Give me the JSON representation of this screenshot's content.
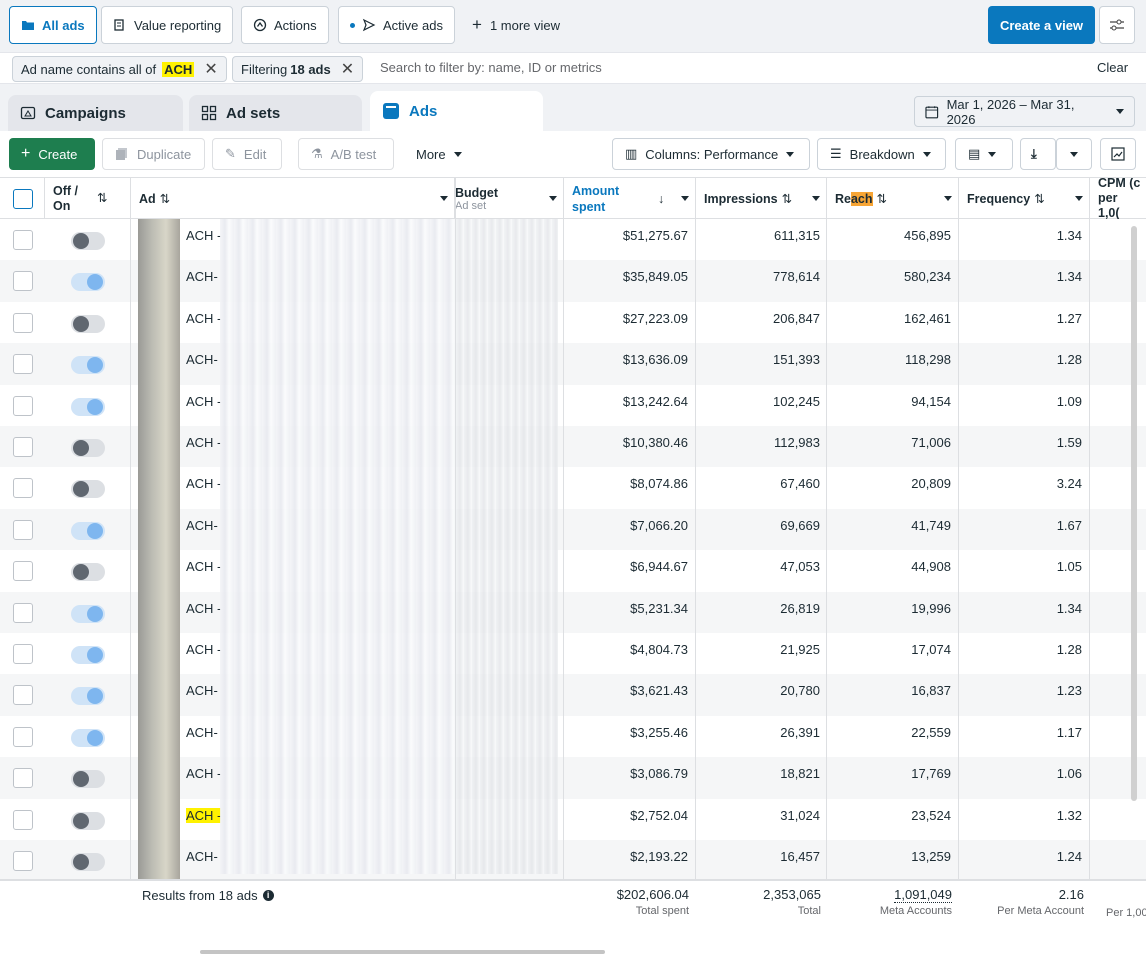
{
  "views": {
    "tabs": [
      {
        "label": "All ads",
        "icon": "folder-icon"
      },
      {
        "label": "Value reporting",
        "icon": "report-icon"
      },
      {
        "label": "Actions",
        "icon": "actions-icon"
      },
      {
        "label": "Active ads",
        "icon": "send-icon"
      }
    ],
    "more_views": "1 more view",
    "create_view": "Create a view"
  },
  "filters": {
    "chip1_prefix": "Ad name contains all of",
    "chip1_value": "ACH",
    "chip2_prefix": "Filtering",
    "chip2_value": "18 ads",
    "search_placeholder": "Search to filter by: name, ID or metrics",
    "clear": "Clear"
  },
  "levels": {
    "campaigns": "Campaigns",
    "adsets": "Ad sets",
    "ads": "Ads"
  },
  "date_range": "Mar 1, 2026 – Mar 31, 2026",
  "toolbar": {
    "create": "Create",
    "duplicate": "Duplicate",
    "edit": "Edit",
    "ab_test": "A/B test",
    "more": "More",
    "columns": "Columns: Performance",
    "breakdown": "Breakdown"
  },
  "columns": {
    "offon": "Off / On",
    "ad": "Ad",
    "budget": "Budget",
    "budget_sub": "Ad set",
    "amount": "Amount spent",
    "impressions": "Impressions",
    "reach_pre": "Re",
    "reach_hl": "ach",
    "frequency": "Frequency",
    "cpm": "CPM (c per 1,0("
  },
  "rows": [
    {
      "on": false,
      "name": "ACH -",
      "spent": "$51,275.67",
      "impr": "611,315",
      "reach": "456,895",
      "freq": "1.34"
    },
    {
      "on": true,
      "name": "ACH-",
      "spent": "$35,849.05",
      "impr": "778,614",
      "reach": "580,234",
      "freq": "1.34"
    },
    {
      "on": false,
      "name": "ACH -",
      "spent": "$27,223.09",
      "impr": "206,847",
      "reach": "162,461",
      "freq": "1.27"
    },
    {
      "on": true,
      "name": "ACH-",
      "spent": "$13,636.09",
      "impr": "151,393",
      "reach": "118,298",
      "freq": "1.28"
    },
    {
      "on": true,
      "name": "ACH -",
      "spent": "$13,242.64",
      "impr": "102,245",
      "reach": "94,154",
      "freq": "1.09"
    },
    {
      "on": false,
      "name": "ACH -",
      "spent": "$10,380.46",
      "impr": "112,983",
      "reach": "71,006",
      "freq": "1.59"
    },
    {
      "on": false,
      "name": "ACH -",
      "spent": "$8,074.86",
      "impr": "67,460",
      "reach": "20,809",
      "freq": "3.24"
    },
    {
      "on": true,
      "name": "ACH-",
      "spent": "$7,066.20",
      "impr": "69,669",
      "reach": "41,749",
      "freq": "1.67"
    },
    {
      "on": false,
      "name": "ACH -",
      "spent": "$6,944.67",
      "impr": "47,053",
      "reach": "44,908",
      "freq": "1.05"
    },
    {
      "on": true,
      "name": "ACH -",
      "spent": "$5,231.34",
      "impr": "26,819",
      "reach": "19,996",
      "freq": "1.34"
    },
    {
      "on": true,
      "name": "ACH -",
      "spent": "$4,804.73",
      "impr": "21,925",
      "reach": "17,074",
      "freq": "1.28"
    },
    {
      "on": true,
      "name": "ACH-",
      "spent": "$3,621.43",
      "impr": "20,780",
      "reach": "16,837",
      "freq": "1.23"
    },
    {
      "on": true,
      "name": "ACH-",
      "spent": "$3,255.46",
      "impr": "26,391",
      "reach": "22,559",
      "freq": "1.17"
    },
    {
      "on": false,
      "name": "ACH -",
      "spent": "$3,086.79",
      "impr": "18,821",
      "reach": "17,769",
      "freq": "1.06"
    },
    {
      "on": false,
      "name": "ACH -",
      "spent": "$2,752.04",
      "impr": "31,024",
      "reach": "23,524",
      "freq": "1.32"
    },
    {
      "on": false,
      "name": "ACH-",
      "spent": "$2,193.22",
      "impr": "16,457",
      "reach": "13,259",
      "freq": "1.24"
    }
  ],
  "footer": {
    "results": "Results from 18 ads",
    "spent": "$202,606.04",
    "spent_lbl": "Total spent",
    "impr": "2,353,065",
    "impr_lbl": "Total",
    "reach": "1,091,049",
    "reach_lbl": "Meta Accounts",
    "freq": "2.16",
    "freq_lbl": "Per Meta Account",
    "cpm_lbl": "Per 1,00"
  },
  "colors": {
    "accent": "#0a78be",
    "create": "#1e7e4f",
    "highlight": "#fff200"
  }
}
